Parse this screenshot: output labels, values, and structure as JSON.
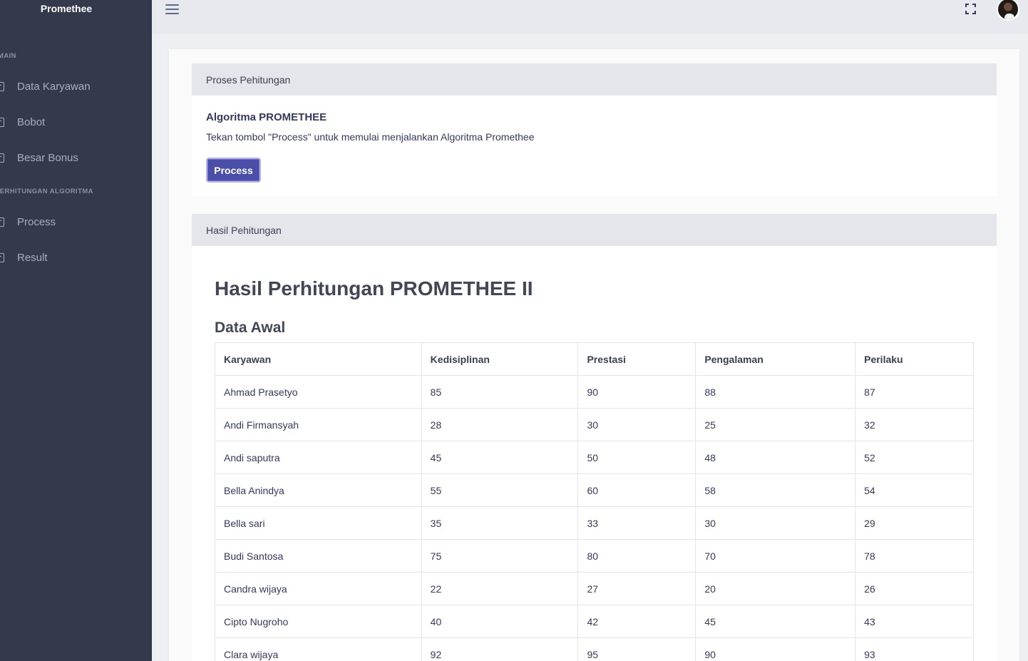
{
  "sidebar": {
    "brand": "Promethee",
    "sections": [
      {
        "header": "MAIN",
        "items": [
          {
            "label": "Data Karyawan",
            "icon": "document-icon"
          },
          {
            "label": "Bobot",
            "icon": "document-icon"
          },
          {
            "label": "Besar Bonus",
            "icon": "document-icon"
          }
        ]
      },
      {
        "header": "PERHITUNGAN ALGORITMA",
        "items": [
          {
            "label": "Process",
            "icon": "document-icon"
          },
          {
            "label": "Result",
            "icon": "document-icon"
          }
        ]
      }
    ]
  },
  "topbar": {
    "menu_icon": "hamburger-icon",
    "fullscreen_icon": "fullscreen-icon",
    "avatar_icon": "user-avatar"
  },
  "process_panel": {
    "header": "Proses Pehitungan",
    "title": "Algoritma PROMETHEE",
    "description": "Tekan tombol \"Process\" untuk memulai menjalankan Algoritma Promethee",
    "button_label": "Process"
  },
  "result_panel": {
    "header": "Hasil Pehitungan",
    "title": "Hasil Perhitungan PROMETHEE II",
    "subtitle": "Data Awal",
    "table": {
      "columns": [
        "Karyawan",
        "Kedisiplinan",
        "Prestasi",
        "Pengalaman",
        "Perilaku"
      ],
      "rows": [
        [
          "Ahmad Prasetyo",
          "85",
          "90",
          "88",
          "87"
        ],
        [
          "Andi Firmansyah",
          "28",
          "30",
          "25",
          "32"
        ],
        [
          "Andi saputra",
          "45",
          "50",
          "48",
          "52"
        ],
        [
          "Bella Anindya",
          "55",
          "60",
          "58",
          "54"
        ],
        [
          "Bella sari",
          "35",
          "33",
          "30",
          "29"
        ],
        [
          "Budi Santosa",
          "75",
          "80",
          "70",
          "78"
        ],
        [
          "Candra wijaya",
          "22",
          "27",
          "20",
          "26"
        ],
        [
          "Cipto Nugroho",
          "40",
          "42",
          "45",
          "43"
        ],
        [
          "Clara wijaya",
          "92",
          "95",
          "90",
          "93"
        ]
      ]
    }
  },
  "colors": {
    "sidebar_bg": "#343a4b",
    "primary_button": "#4a4ea8",
    "panel_header_bg": "#e4e6eb"
  }
}
